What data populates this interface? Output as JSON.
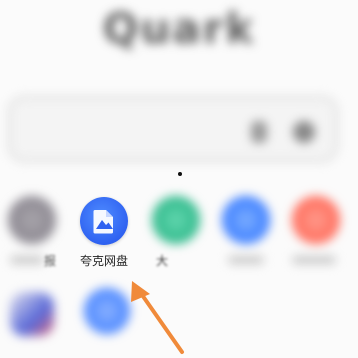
{
  "header": {
    "logo_text": "Quark"
  },
  "search": {
    "placeholder": ""
  },
  "apps": [
    {
      "label": "报",
      "icon": "app-icon-gray",
      "color": "#8a8a8a"
    },
    {
      "label": "夸克网盘",
      "icon": "cloud-drive-icon",
      "color": "#2f62f1"
    },
    {
      "label": "大",
      "icon": "app-icon-green",
      "color": "#2fb88a"
    },
    {
      "label": "",
      "icon": "app-icon-blue",
      "color": "#3b7dff"
    },
    {
      "label": "",
      "icon": "app-icon-red",
      "color": "#ff6b5a"
    }
  ],
  "colors": {
    "arrow": "#f08a3a",
    "cloud_drive": "#2f62f1"
  }
}
